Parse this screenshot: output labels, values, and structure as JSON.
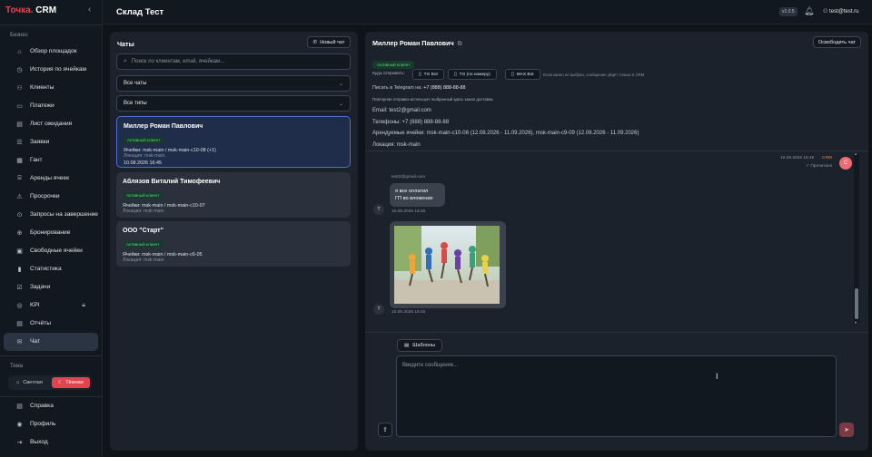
{
  "sidebar": {
    "logo_prefix": "Точка.",
    "logo_suffix": " CRM",
    "collapse_icon": "‹",
    "section_business": "Бизнес",
    "items": [
      {
        "label": "Обзор площадок",
        "icon": "⌂"
      },
      {
        "label": "История по ячейкам",
        "icon": "◷"
      },
      {
        "label": "Клиенты",
        "icon": "⚇"
      },
      {
        "label": "Платежи",
        "icon": "▭"
      },
      {
        "label": "Лист ожидания",
        "icon": "▤"
      },
      {
        "label": "Заявки",
        "icon": "☰"
      },
      {
        "label": "Гант",
        "icon": "▦"
      },
      {
        "label": "Аренды ячеек",
        "icon": "⌸"
      },
      {
        "label": "Просрочки",
        "icon": "⚠"
      },
      {
        "label": "Запросы на завершение",
        "icon": "⊙"
      },
      {
        "label": "Бронирование",
        "icon": "⊕"
      },
      {
        "label": "Свободные ячейки",
        "icon": "▣"
      },
      {
        "label": "Статистика",
        "icon": "▮"
      },
      {
        "label": "Задачи",
        "icon": "☑"
      },
      {
        "label": "KPI",
        "icon": "◎",
        "locked": true
      },
      {
        "label": "Отчёты",
        "icon": "▤"
      },
      {
        "label": "Чат",
        "icon": "✉",
        "active": true
      }
    ],
    "section_theme": "Тема",
    "theme_light": "Светлая",
    "theme_dark": "Тёмная",
    "bottom": [
      {
        "label": "Справка",
        "icon": "▤"
      },
      {
        "label": "Профиль",
        "icon": "◉"
      },
      {
        "label": "Выход",
        "icon": "⇥"
      }
    ]
  },
  "header": {
    "title": "Склад Тест",
    "version": "v1.0.5",
    "user": "test@test.ru"
  },
  "chats": {
    "title": "Чаты",
    "new_chat": "Новый чат",
    "search_placeholder": "Поиск по клиентам, email, ячейкам...",
    "filter_chats": "Все чаты",
    "filter_types": "Все типы",
    "items": [
      {
        "name": "Миллер Роман Павлович",
        "badge": "Активный клиент",
        "cells": "Ячейки: msk-main / msk-main-c10-08 (+1)",
        "location": "Локация: msk-main",
        "time": "10.08.2026 16:45",
        "selected": true
      },
      {
        "name": "Аблязов Виталий Тимофеевич",
        "badge": "Активный клиент",
        "cells": "Ячейки: msk-main / msk-main-c10-07",
        "location": "Локация: msk-main"
      },
      {
        "name": "ООО \"Старт\"",
        "badge": "Активный клиент",
        "cells": "Ячейки: msk-main / msk-main-c6-05",
        "location": "Локация: msk-main"
      }
    ]
  },
  "convo": {
    "title": "Миллер Роман Павлович",
    "release_chat": "Освободить чат",
    "badge": "Активный клиент",
    "send_to_label": "Куда отправить:",
    "channels": [
      "TG Bot",
      "TG (по номеру)",
      "MAX Bot"
    ],
    "channel_hint": "Если канал не выбран, сообщение уйдёт только в CRM",
    "telegram_label": "Писать в Telegram на:",
    "telegram_phone": "+7 (888) 888-88-88",
    "repeat_hint": "Повторная отправка использует выбранный здесь канал доставки.",
    "email": "Email: test2@gmail.com",
    "phones": "Телефоны: +7 (888) 888-88-88",
    "cells": "Арендуемые ячейки: msk-main-c10-08 (12.08.2026 - 11.09.2026), msk-main-c9-09 (12.08.2026 - 11.09.2026)",
    "location": "Локация: msk-main",
    "out_time": "10.08.2026 16:45",
    "out_tag": "CRM",
    "out_read": "✓ Прочитано",
    "out_avatar": "C",
    "in_sender": "test2@gmail.com",
    "in_text_1": "я все оплатил",
    "in_text_2": "ГП во вложение",
    "in_time_1": "10.08.2026 16:45",
    "in_time_2": "10.08.2026 16:45",
    "in_avatar": "T",
    "templates": "Шаблоны",
    "input_placeholder": "Введите сообщение..."
  }
}
